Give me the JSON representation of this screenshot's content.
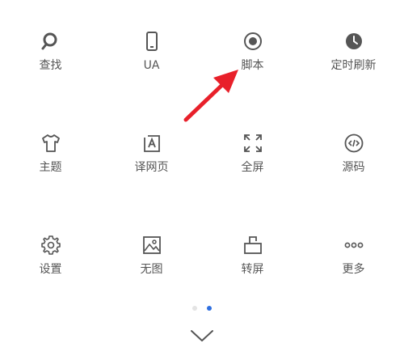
{
  "menu": {
    "items": [
      {
        "label": "查找",
        "icon": "search-icon"
      },
      {
        "label": "UA",
        "icon": "phone-icon"
      },
      {
        "label": "脚本",
        "icon": "script-icon"
      },
      {
        "label": "定时刷新",
        "icon": "clock-icon"
      },
      {
        "label": "主题",
        "icon": "shirt-icon"
      },
      {
        "label": "译网页",
        "icon": "translate-icon"
      },
      {
        "label": "全屏",
        "icon": "fullscreen-icon"
      },
      {
        "label": "源码",
        "icon": "code-icon"
      },
      {
        "label": "设置",
        "icon": "gear-icon"
      },
      {
        "label": "无图",
        "icon": "image-icon"
      },
      {
        "label": "转屏",
        "icon": "rotate-icon"
      },
      {
        "label": "更多",
        "icon": "more-icon"
      }
    ]
  },
  "pager": {
    "pages": 2,
    "active_page": 2,
    "active_color": "#2f6fe0",
    "inactive_color": "#e4e4e4"
  },
  "annotation": {
    "arrow_color": "#e8202a",
    "points_to": "脚本"
  },
  "colors": {
    "icon": "#555555",
    "label": "#555555",
    "background": "#ffffff"
  }
}
